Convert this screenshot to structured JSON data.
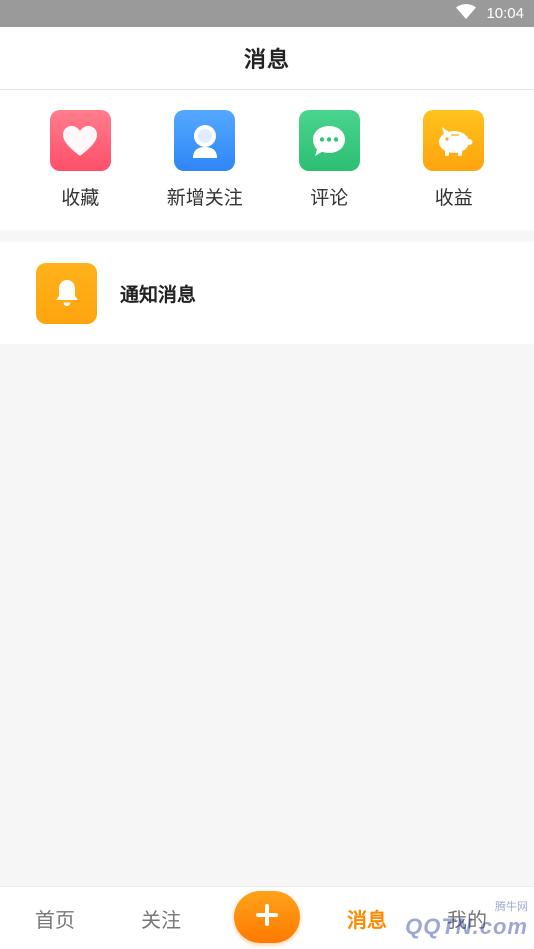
{
  "status_bar": {
    "time": "10:04",
    "wifi_icon": "wifi-icon"
  },
  "header": {
    "title": "消息"
  },
  "quick_actions": [
    {
      "label": "收藏",
      "icon": "heart-icon",
      "color": "#ff5a72"
    },
    {
      "label": "新增关注",
      "icon": "user-icon",
      "color": "#3b8ff7"
    },
    {
      "label": "评论",
      "icon": "chat-bubble-icon",
      "color": "#33c37b"
    },
    {
      "label": "收益",
      "icon": "piggy-bank-icon",
      "color": "#ffaa12"
    }
  ],
  "notifications": {
    "label": "通知消息",
    "icon": "bell-icon",
    "color": "#ffa91a"
  },
  "bottom_nav": {
    "items": [
      {
        "label": "首页",
        "active": false
      },
      {
        "label": "关注",
        "active": false
      },
      {
        "label": "消息",
        "active": true
      },
      {
        "label": "我的",
        "active": false
      }
    ],
    "plus_icon": "plus-icon",
    "accent": "#ff8a00"
  },
  "watermark": {
    "small": "腾牛网",
    "big": "QQTN.com"
  }
}
